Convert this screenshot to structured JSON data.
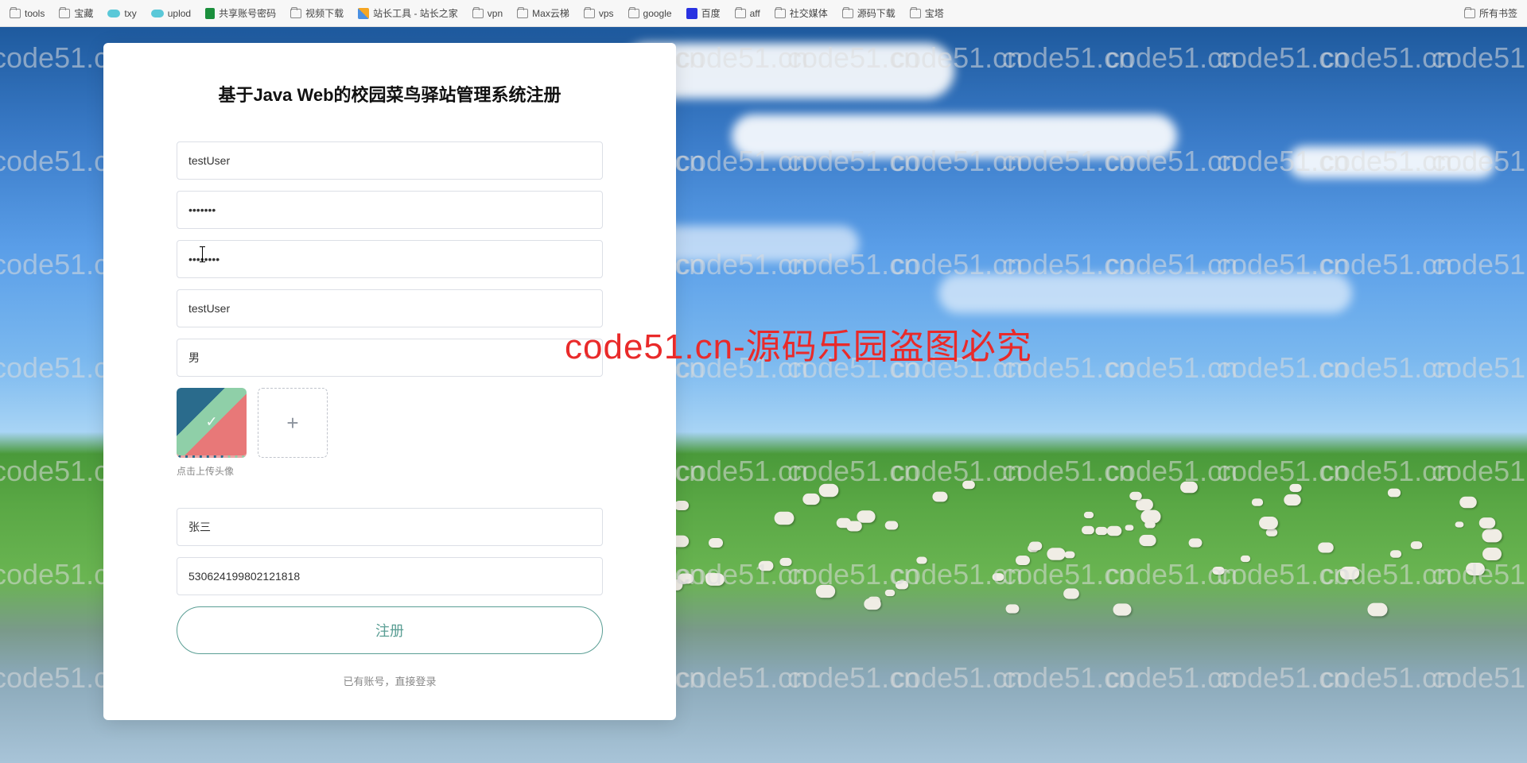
{
  "bookmarks": {
    "items": [
      {
        "label": "tools",
        "icon": "folder"
      },
      {
        "label": "宝藏",
        "icon": "folder"
      },
      {
        "label": "txy",
        "icon": "cloud"
      },
      {
        "label": "uplod",
        "icon": "cloud"
      },
      {
        "label": "共享账号密码",
        "icon": "doc"
      },
      {
        "label": "视频下载",
        "icon": "folder"
      },
      {
        "label": "站长工具 - 站长之家",
        "icon": "site"
      },
      {
        "label": "vpn",
        "icon": "folder"
      },
      {
        "label": "Max云梯",
        "icon": "folder"
      },
      {
        "label": "vps",
        "icon": "folder"
      },
      {
        "label": "google",
        "icon": "folder"
      },
      {
        "label": "百度",
        "icon": "baidu"
      },
      {
        "label": "aff",
        "icon": "folder"
      },
      {
        "label": "社交媒体",
        "icon": "folder"
      },
      {
        "label": "源码下载",
        "icon": "folder"
      },
      {
        "label": "宝塔",
        "icon": "folder"
      }
    ],
    "right": {
      "label": "所有书签",
      "icon": "folder"
    }
  },
  "watermark": {
    "text": "code51.cn",
    "center": "code51.cn-源码乐园盗图必究"
  },
  "form": {
    "title": "基于Java Web的校园菜鸟驿站管理系统注册",
    "username": "testUser",
    "password": "•••••••",
    "confirm_password": "••••••••",
    "nickname": "testUser",
    "gender": "男",
    "upload_hint": "点击上传头像",
    "realname": "张三",
    "idcard": "530624199802121818",
    "submit": "注册",
    "login_link": "已有账号，直接登录"
  }
}
